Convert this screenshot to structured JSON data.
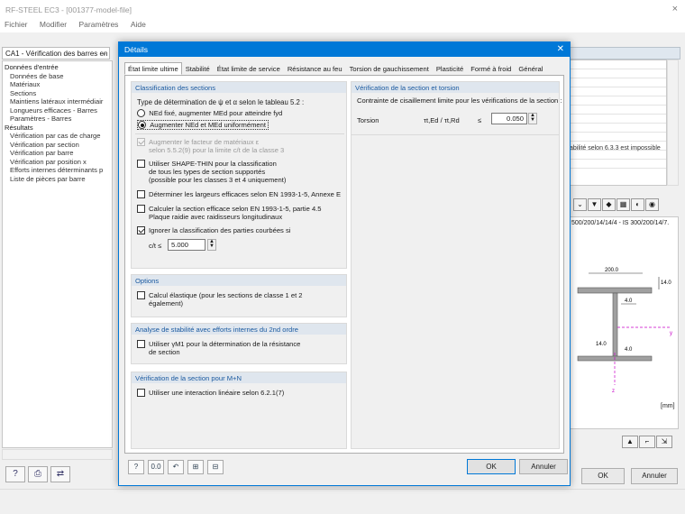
{
  "window": {
    "title": "RF-STEEL EC3 - [001377-model-file]",
    "close_glyph": "×"
  },
  "menu": [
    "Fichier",
    "Modifier",
    "Paramètres",
    "Aide"
  ],
  "case_combo": "CA1 - Vérification des barres en",
  "tree": [
    {
      "level": 0,
      "label": "Données d'entrée"
    },
    {
      "level": 1,
      "label": "Données de base"
    },
    {
      "level": 1,
      "label": "Matériaux"
    },
    {
      "level": 1,
      "label": "Sections"
    },
    {
      "level": 1,
      "label": "Maintiens latéraux intermédiair"
    },
    {
      "level": 1,
      "label": "Longueurs efficaces - Barres"
    },
    {
      "level": 1,
      "label": "Paramètres - Barres"
    },
    {
      "level": 0,
      "label": "Résultats"
    },
    {
      "level": 1,
      "label": "Vérification par cas de charge"
    },
    {
      "level": 1,
      "label": "Vérification par section"
    },
    {
      "level": 1,
      "label": "Vérification par barre"
    },
    {
      "level": 1,
      "label": "Vérification par position x"
    },
    {
      "level": 1,
      "label": "Efforts internes déterminants p"
    },
    {
      "level": 1,
      "label": "Liste de pièces par barre"
    }
  ],
  "right_panel": {
    "stability_note": "abilité selon 6.3.3 est impossible",
    "section_title": "500/200/14/14/4 - IS 300/200/14/7.",
    "dim_width": "200.0",
    "dim_flange": "14.0",
    "dim_web": "4.0",
    "dim_web2": "4.0",
    "dim_flange2": "14.0",
    "axis_y": "y",
    "axis_z": "z",
    "unit": "[mm]",
    "ok_label": "OK",
    "cancel_label": "Annuler"
  },
  "dialog": {
    "title": "Détails",
    "close_glyph": "✕",
    "tabs": [
      "État limite ultime",
      "Stabilité",
      "État limite de service",
      "Résistance au feu",
      "Torsion de gauchissement",
      "Plasticité",
      "Formé à froid",
      "Général"
    ],
    "active_tab": 0,
    "classification": {
      "header": "Classification des sections",
      "question": "Type de détermination de ψ et α selon le tableau 5.2 :",
      "radio1": "NEd fixé, augmenter MEd pour atteindre fyd",
      "radio2": "Augmenter NEd et MEd uniformément",
      "selected": 2,
      "cb_material": "Augmenter le facteur de matériaux ε",
      "cb_material_2": "selon 5.5.2(9) pour la limite c/t de la classe 3",
      "cb_shape": "Utiliser SHAPE-THIN pour la classification",
      "cb_shape_2": "de tous les types de section supportés",
      "cb_shape_3": "(possible pour les classes 3 et 4 uniquement)",
      "cb_widths": "Déterminer les largeurs efficaces selon EN 1993-1-5, Annexe E",
      "cb_effective": "Calculer la section efficace selon EN 1993-1-5, partie 4.5",
      "cb_effective_2": "Plaque raidie avec raidisseurs longitudinaux",
      "cb_ignore": "Ignorer la classification des parties courbées si",
      "ct_label": "c/t ≤",
      "ct_value": "5.000"
    },
    "options": {
      "header": "Options",
      "cb_elastic": "Calcul élastique (pour les sections de classe 1 et 2",
      "cb_elastic_2": "également)"
    },
    "stability": {
      "header": "Analyse de stabilité avec efforts internes du 2nd ordre",
      "cb_gamma": "Utiliser γM1 pour la détermination de la résistance",
      "cb_gamma_2": "de section"
    },
    "mn": {
      "header": "Vérification de la section pour M+N",
      "cb_linear": "Utiliser une interaction linéaire selon 6.2.1(7)"
    },
    "torsion": {
      "header": "Vérification de la section et torsion",
      "desc": "Contrainte de cisaillement limite pour les vérifications de la section :",
      "label": "Torsion",
      "ratio": "τt,Ed / τt,Rd",
      "op": "≤",
      "value": "0.050"
    },
    "ok_label": "OK",
    "cancel_label": "Annuler"
  }
}
